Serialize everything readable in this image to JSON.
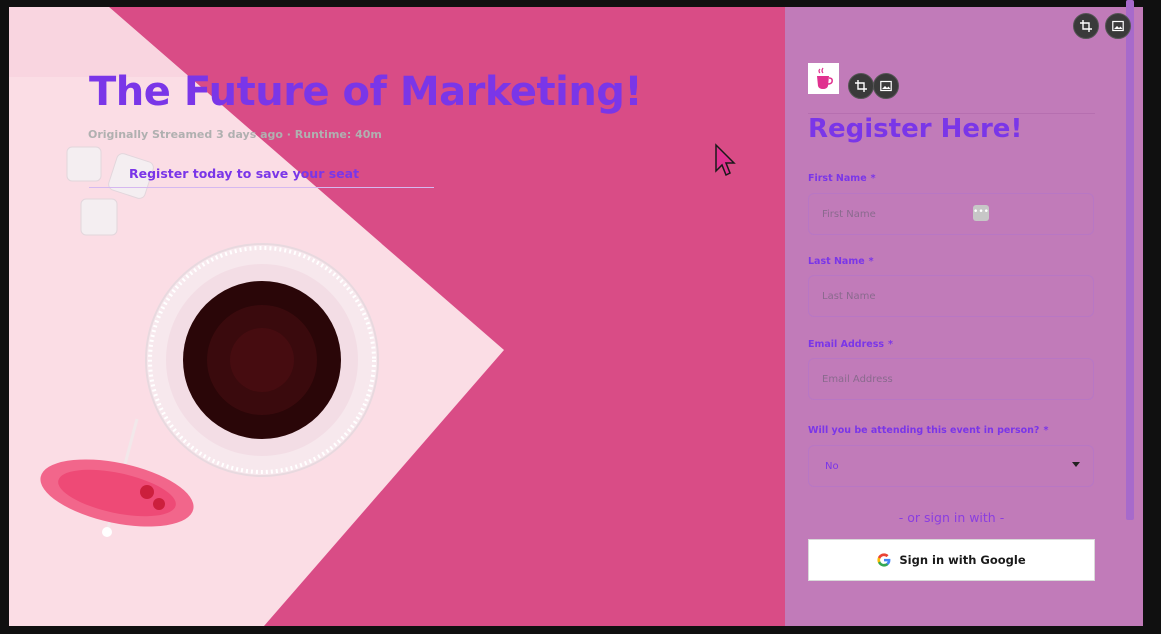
{
  "hero": {
    "title": "The Future of Marketing!",
    "subtitle": "Originally Streamed 3 days ago · Runtime: 40m",
    "cta": "Register today to save your seat"
  },
  "toolbar": {
    "crop_icon": "crop-icon",
    "image_icon": "image-icon"
  },
  "form": {
    "title": "Register Here!",
    "required_mark": "*",
    "first_name": {
      "label": "First Name",
      "placeholder": "First Name",
      "value": ""
    },
    "last_name": {
      "label": "Last Name",
      "placeholder": "Last Name",
      "value": ""
    },
    "email": {
      "label": "Email Address",
      "placeholder": "Email Address",
      "value": ""
    },
    "attending": {
      "label": "Will you be attending this event in person?",
      "selected": "No"
    },
    "divider_text": "- or sign in with -",
    "google_button": "Sign in with Google"
  },
  "colors": {
    "accent": "#7a36e8",
    "panel_bg": "#c17bb9",
    "hero_bg": "#d94c86"
  }
}
